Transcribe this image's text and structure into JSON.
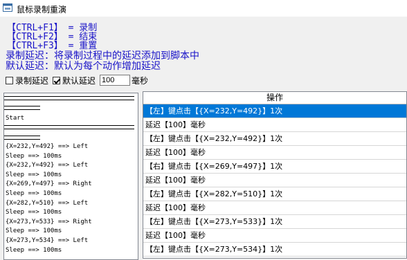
{
  "window": {
    "title": "鼠标录制重演",
    "icon": "app-window-icon"
  },
  "hotkeys": [
    {
      "text": "【CTRL+F1】 = 录制"
    },
    {
      "text": "【CTRL+F2】 = 结束"
    },
    {
      "text": "【CTRL+F3】 = 重置"
    }
  ],
  "descriptions": {
    "record_delay": "录制延迟：将录制过程中的延迟添加到脚本中",
    "default_delay": "默认延迟：默认为每个动作增加延迟"
  },
  "options": {
    "record_delay_label": "录制延迟",
    "record_delay_checked": false,
    "default_delay_label": "默认延迟",
    "default_delay_checked": true,
    "default_delay_value": "100",
    "unit_label": "毫秒"
  },
  "log": {
    "start": "Start",
    "lines": [
      "{X=232,Y=492} ==> Left",
      "Sleep ==> 100ms",
      "{X=232,Y=492} ==> Left",
      "Sleep ==> 100ms",
      "{X=269,Y=497} ==> Right",
      "Sleep ==> 100ms",
      "{X=282,Y=510} ==> Left",
      "Sleep ==> 100ms",
      "{X=273,Y=533} ==> Right",
      "Sleep ==> 100ms",
      "{X=273,Y=534} ==> Left",
      "Sleep ==> 100ms"
    ]
  },
  "grid": {
    "header": "操作",
    "rows": [
      "【左】键点击【{X=232,Y=492}】1次",
      "延迟【100】毫秒",
      "【左】键点击【{X=232,Y=492}】1次",
      "延迟【100】毫秒",
      "【右】键点击【{X=269,Y=497}】1次",
      "延迟【100】毫秒",
      "【左】键点击【{X=282,Y=510}】1次",
      "延迟【100】毫秒",
      "【左】键点击【{X=273,Y=533}】1次",
      "延迟【100】毫秒",
      "【左】键点击【{X=273,Y=534}】1次"
    ],
    "selected_index": 0
  },
  "colors": {
    "accent": "#1a14c8",
    "selection": "#0078d7"
  }
}
